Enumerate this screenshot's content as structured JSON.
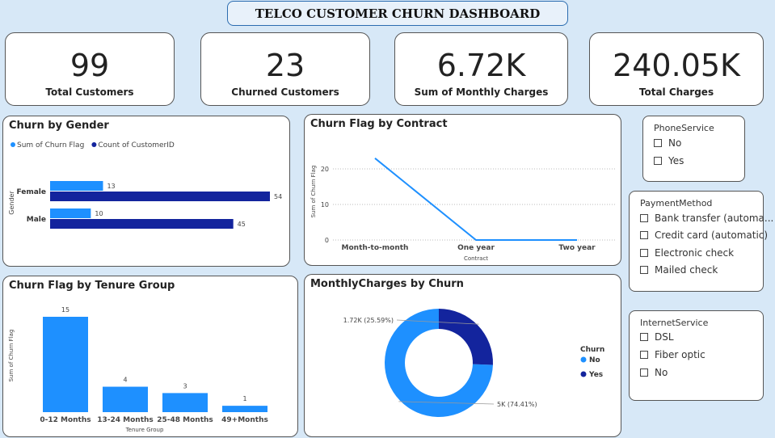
{
  "dashboard_title": "TELCO CUSTOMER CHURN DASHBOARD",
  "kpis": [
    {
      "value": "99",
      "label": "Total Customers"
    },
    {
      "value": "23",
      "label": "Churned Customers"
    },
    {
      "value": "6.72K",
      "label": "Sum of Monthly Charges"
    },
    {
      "value": "240.05K",
      "label": "Total Charges"
    }
  ],
  "colors": {
    "light_blue": "#1e90ff",
    "dark_blue": "#13249d"
  },
  "chart_data": [
    {
      "type": "bar",
      "orientation": "horizontal",
      "title": "Churn by Gender",
      "ylabel": "Gender",
      "categories": [
        "Female",
        "Male"
      ],
      "series": [
        {
          "name": "Sum of Churn Flag",
          "values": [
            13,
            10
          ],
          "color": "#1e90ff"
        },
        {
          "name": "Count of CustomerID",
          "values": [
            54,
            45
          ],
          "color": "#13249d"
        }
      ],
      "legend": "top-left"
    },
    {
      "type": "line",
      "title": "Churn Flag by Contract",
      "xlabel": "Contract",
      "ylabel": "Sum of Churn Flag",
      "categories": [
        "Month-to-month",
        "One year",
        "Two year"
      ],
      "values": [
        23,
        0,
        0
      ],
      "yticks": [
        0,
        10,
        20
      ],
      "ylim": [
        0,
        25
      ],
      "grid": true
    },
    {
      "type": "bar",
      "title": "Churn Flag by Tenure Group",
      "xlabel": "Tenure Group",
      "ylabel": "Sum of Churn Flag",
      "categories": [
        "0-12 Months",
        "13-24 Months",
        "25-48 Months",
        "49+Months"
      ],
      "values": [
        15,
        4,
        3,
        1
      ]
    },
    {
      "type": "pie",
      "donut": true,
      "title": "MonthlyCharges by Churn",
      "legend_title": "Churn",
      "slices": [
        {
          "name": "No",
          "value": 5000,
          "label": "5K (74.41%)",
          "color": "#1e90ff"
        },
        {
          "name": "Yes",
          "value": 1720,
          "label": "1.72K (25.59%)",
          "color": "#13249d"
        }
      ],
      "legend": "right"
    }
  ],
  "slicers": {
    "phone": {
      "title": "PhoneService",
      "items": [
        "No",
        "Yes"
      ]
    },
    "payment": {
      "title": "PaymentMethod",
      "items": [
        "Bank transfer (automa...",
        "Credit card (automatic)",
        "Electronic check",
        "Mailed check"
      ]
    },
    "internet": {
      "title": "InternetService",
      "items": [
        "DSL",
        "Fiber optic",
        "No"
      ]
    }
  }
}
